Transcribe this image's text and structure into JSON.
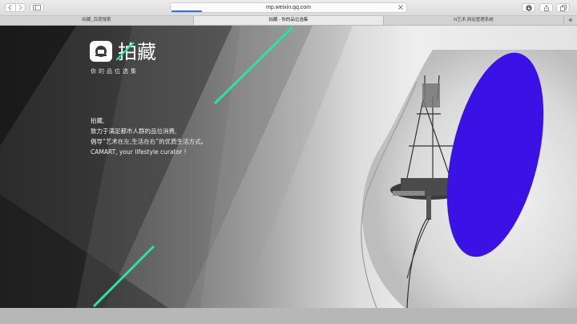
{
  "browser": {
    "url": "mp.weixin.qq.com",
    "load_progress": 0.13,
    "tabs": [
      {
        "label": "拍藏_百度搜索",
        "active": false
      },
      {
        "label": "拍藏 - 你的品位选集",
        "active": true
      },
      {
        "label": "N艺术 网站管理系统",
        "active": false
      }
    ],
    "icons": {
      "back": "chevron-left-icon",
      "forward": "chevron-right-icon",
      "sidebar": "sidebar-icon",
      "stop": "close-icon",
      "download": "download-icon",
      "share": "share-icon",
      "tabs": "tabs-icon",
      "new_tab": "plus-icon"
    }
  },
  "page": {
    "brand": {
      "name": "拍藏",
      "slogan": "你的品位选集",
      "logo_icon": "camera-frame-icon"
    },
    "intro_lines": [
      "拍藏,",
      "致力于满足都市人群的品位消费,",
      "倡导“艺术在左,生活在右”的优质生活方式。",
      " CAMART, your lifestyle curator !"
    ],
    "colors": {
      "accent": "#2ee0a8",
      "ellipse": "#3a12e6"
    }
  }
}
